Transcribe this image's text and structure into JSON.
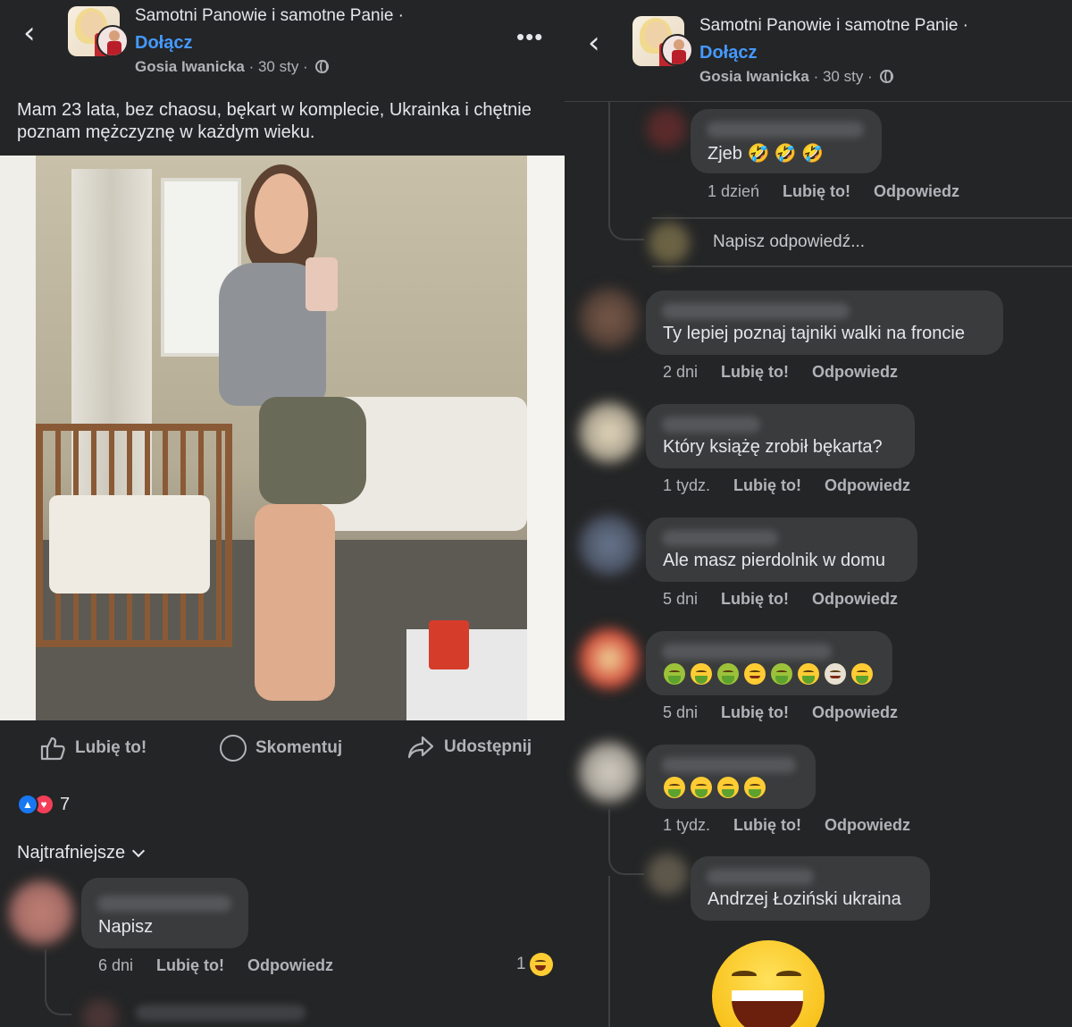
{
  "left": {
    "header": {
      "group_title": "Samotni Panowie i samotne Panie ·",
      "join": "Dołącz",
      "author": "Gosia Iwanicka",
      "date": "· 30 sty ·"
    },
    "post_text": "Mam 23 lata, bez chaosu, bękart w komplecie, Ukrainka i chętnie poznam mężczyznę w każdym wieku.",
    "actions": {
      "like": "Lubię to!",
      "comment": "Skomentuj",
      "share": "Udostępnij"
    },
    "reaction_count": "7",
    "sort_label": "Najtrafniejsze",
    "comment": {
      "text": "Napisz",
      "time": "6 dni",
      "like": "Lubię to!",
      "reply": "Odpowiedz",
      "reactions": "1"
    }
  },
  "right": {
    "header": {
      "group_title": "Samotni Panowie i samotne Panie ·",
      "join": "Dołącz",
      "author": "Gosia Iwanicka",
      "date": "· 30 sty ·"
    },
    "write_reply_placeholder": "Napisz odpowiedź...",
    "comments": [
      {
        "text": "Zjeb 🤣 🤣 🤣",
        "time": "1 dzień",
        "like": "Lubię to!",
        "reply": "Odpowiedz"
      },
      {
        "text": "Ty lepiej poznaj tajniki walki na froncie",
        "time": "2 dni",
        "like": "Lubię to!",
        "reply": "Odpowiedz"
      },
      {
        "text": "Który książę zrobił bękarta?",
        "time": "1 tydz.",
        "like": "Lubię to!",
        "reply": "Odpowiedz"
      },
      {
        "text": "Ale masz pierdolnik w domu",
        "time": "5 dni",
        "like": "Lubię to!",
        "reply": "Odpowiedz"
      },
      {
        "text": "",
        "time": "5 dni",
        "like": "Lubię to!",
        "reply": "Odpowiedz"
      },
      {
        "text": "",
        "time": "1 tydz.",
        "like": "Lubię to!",
        "reply": "Odpowiedz"
      },
      {
        "text": "Andrzej Łoziński ukraina"
      }
    ]
  },
  "colors": {
    "background": "#242526",
    "bubble": "#3a3b3c",
    "accent": "#4599ff",
    "text": "#e4e6eb",
    "muted": "#b0b3b8"
  }
}
